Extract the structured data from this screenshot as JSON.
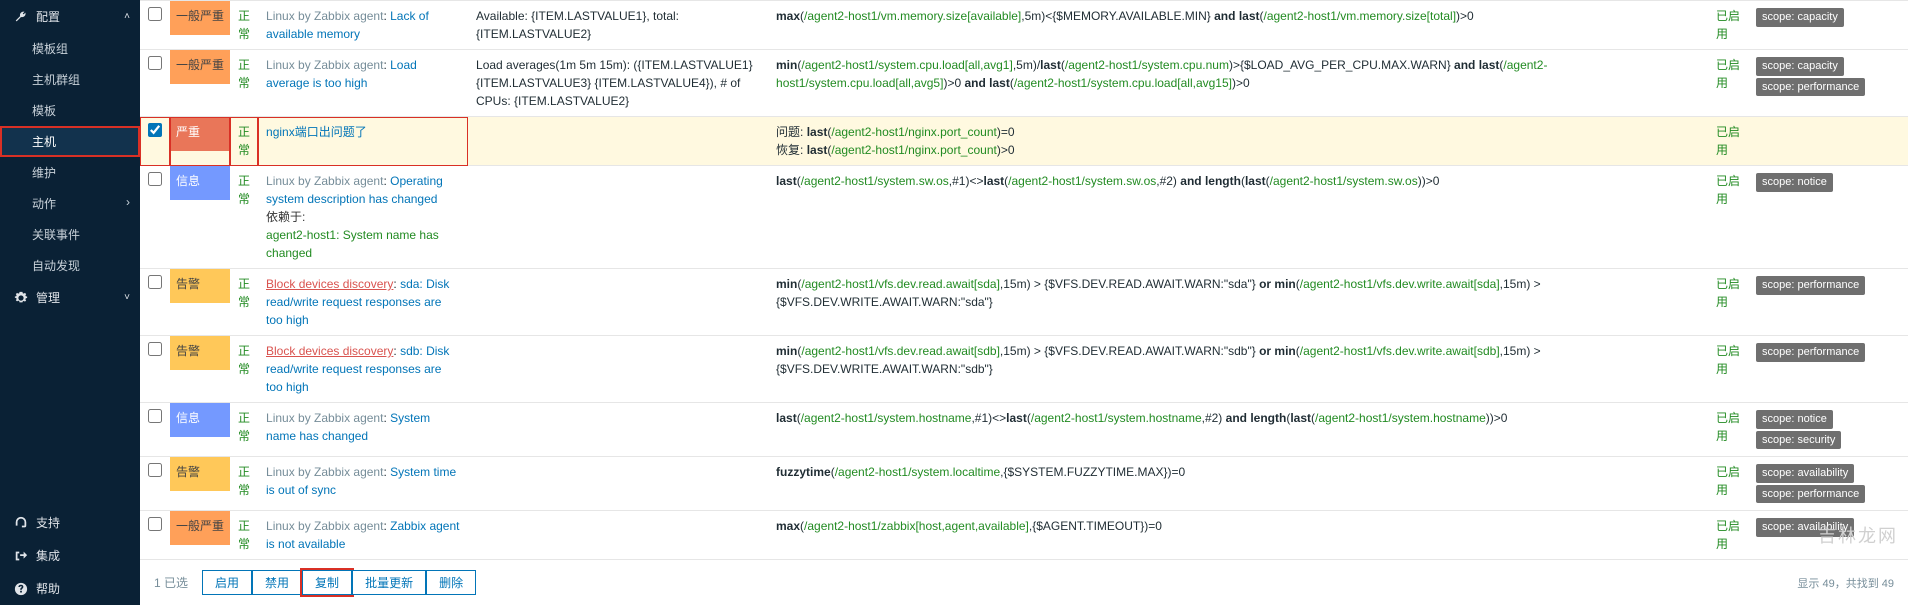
{
  "sidebar": {
    "sections": [
      {
        "label": "配置",
        "icon": "wrench",
        "expanded": true,
        "items": [
          {
            "label": "模板组"
          },
          {
            "label": "主机群组"
          },
          {
            "label": "模板"
          },
          {
            "label": "主机",
            "active": true,
            "box": true
          },
          {
            "label": "维护"
          },
          {
            "label": "动作",
            "chev": true
          },
          {
            "label": "关联事件"
          },
          {
            "label": "自动发现"
          }
        ]
      },
      {
        "label": "管理",
        "icon": "gear",
        "expanded": false,
        "items": []
      }
    ],
    "bottom": [
      {
        "label": "支持",
        "icon": "headset"
      },
      {
        "label": "集成",
        "icon": "share"
      },
      {
        "label": "帮助",
        "icon": "question"
      }
    ]
  },
  "rows": [
    {
      "checked": false,
      "sev": "一般严重",
      "status": "正常",
      "src": "Linux by Zabbix agent",
      "name": "Lack of available memory",
      "opdata": "Available: {ITEM.LASTVALUE1}, total: {ITEM.LASTVALUE2}",
      "expr": [
        {
          "t": "k",
          "v": "max"
        },
        {
          "t": "",
          "v": "("
        },
        {
          "t": "fn",
          "v": "/agent2-host1/vm.memory.size[available]"
        },
        {
          "t": "",
          "v": ",5m)<{$MEMORY.AVAILABLE.MIN} "
        },
        {
          "t": "k",
          "v": "and"
        },
        {
          "t": "",
          "v": " "
        },
        {
          "t": "k",
          "v": "last"
        },
        {
          "t": "",
          "v": "("
        },
        {
          "t": "fn",
          "v": "/agent2-host1/vm.memory.size[total]"
        },
        {
          "t": "",
          "v": ")>0"
        }
      ],
      "enable": "已启用",
      "tags": [
        "scope: capacity"
      ]
    },
    {
      "checked": false,
      "sev": "一般严重",
      "status": "正常",
      "src": "Linux by Zabbix agent",
      "name": "Load average is too high",
      "opdata": "Load averages(1m 5m 15m): ({ITEM.LASTVALUE1} {ITEM.LASTVALUE3} {ITEM.LASTVALUE4}), # of CPUs: {ITEM.LASTVALUE2}",
      "expr": [
        {
          "t": "k",
          "v": "min"
        },
        {
          "t": "",
          "v": "("
        },
        {
          "t": "fn",
          "v": "/agent2-host1/system.cpu.load[all,avg1]"
        },
        {
          "t": "",
          "v": ",5m)/"
        },
        {
          "t": "k",
          "v": "last"
        },
        {
          "t": "",
          "v": "("
        },
        {
          "t": "fn",
          "v": "/agent2-host1/system.cpu.num"
        },
        {
          "t": "",
          "v": ")>{$LOAD_AVG_PER_CPU.MAX.WARN} "
        },
        {
          "t": "k",
          "v": "and"
        },
        {
          "t": "",
          "v": " "
        },
        {
          "t": "k",
          "v": "last"
        },
        {
          "t": "",
          "v": "("
        },
        {
          "t": "fn",
          "v": "/agent2-host1/system.cpu.load[all,avg5]"
        },
        {
          "t": "",
          "v": ")>0 "
        },
        {
          "t": "k",
          "v": "and"
        },
        {
          "t": "",
          "v": " "
        },
        {
          "t": "k",
          "v": "last"
        },
        {
          "t": "",
          "v": "("
        },
        {
          "t": "fn",
          "v": "/agent2-host1/system.cpu.load[all,avg15]"
        },
        {
          "t": "",
          "v": ")>0"
        }
      ],
      "enable": "已启用",
      "tags": [
        "scope: capacity",
        "scope: performance"
      ]
    },
    {
      "checked": true,
      "highlight": true,
      "box": true,
      "sev": "严重",
      "status": "正常",
      "src": "",
      "name": "nginx端口出问题了",
      "opdata": "",
      "expr_lines": [
        {
          "pre": "问题: ",
          "parts": [
            {
              "t": "k",
              "v": "last"
            },
            {
              "t": "",
              "v": "("
            },
            {
              "t": "fn",
              "v": "/agent2-host1/nginx.port_count"
            },
            {
              "t": "",
              "v": ")=0"
            }
          ]
        },
        {
          "pre": "恢复: ",
          "parts": [
            {
              "t": "k",
              "v": "last"
            },
            {
              "t": "",
              "v": "("
            },
            {
              "t": "fn",
              "v": "/agent2-host1/nginx.port_count"
            },
            {
              "t": "",
              "v": ")>0"
            }
          ]
        }
      ],
      "enable": "已启用",
      "tags": []
    },
    {
      "checked": false,
      "sev": "信息",
      "status": "正常",
      "src": "Linux by Zabbix agent",
      "name": "Operating system description has changed",
      "dep_label": "依赖于:",
      "dep_link": "agent2-host1: System name has changed",
      "opdata": "",
      "expr": [
        {
          "t": "k",
          "v": "last"
        },
        {
          "t": "",
          "v": "("
        },
        {
          "t": "fn",
          "v": "/agent2-host1/system.sw.os"
        },
        {
          "t": "",
          "v": ",#1)<>"
        },
        {
          "t": "k",
          "v": "last"
        },
        {
          "t": "",
          "v": "("
        },
        {
          "t": "fn",
          "v": "/agent2-host1/system.sw.os"
        },
        {
          "t": "",
          "v": ",#2) "
        },
        {
          "t": "k",
          "v": "and"
        },
        {
          "t": "",
          "v": " "
        },
        {
          "t": "k",
          "v": "length"
        },
        {
          "t": "",
          "v": "("
        },
        {
          "t": "k",
          "v": "last"
        },
        {
          "t": "",
          "v": "("
        },
        {
          "t": "fn",
          "v": "/agent2-host1/system.sw.os"
        },
        {
          "t": "",
          "v": "))>0"
        }
      ],
      "enable": "已启用",
      "tags": [
        "scope: notice"
      ]
    },
    {
      "checked": false,
      "sev": "告警",
      "status": "正常",
      "src_red": "Block devices discovery",
      "name": "sda: Disk read/write request responses are too high",
      "opdata": "",
      "expr": [
        {
          "t": "k",
          "v": "min"
        },
        {
          "t": "",
          "v": "("
        },
        {
          "t": "fn",
          "v": "/agent2-host1/vfs.dev.read.await[sda]"
        },
        {
          "t": "",
          "v": ",15m) > {$VFS.DEV.READ.AWAIT.WARN:\"sda\"} "
        },
        {
          "t": "k",
          "v": "or"
        },
        {
          "t": "",
          "v": " "
        },
        {
          "t": "k",
          "v": "min"
        },
        {
          "t": "",
          "v": "("
        },
        {
          "t": "fn",
          "v": "/agent2-host1/vfs.dev.write.await[sda]"
        },
        {
          "t": "",
          "v": ",15m) > {$VFS.DEV.WRITE.AWAIT.WARN:\"sda\"}"
        }
      ],
      "enable": "已启用",
      "tags": [
        "scope: performance"
      ]
    },
    {
      "checked": false,
      "sev": "告警",
      "status": "正常",
      "src_red": "Block devices discovery",
      "name": "sdb: Disk read/write request responses are too high",
      "opdata": "",
      "expr": [
        {
          "t": "k",
          "v": "min"
        },
        {
          "t": "",
          "v": "("
        },
        {
          "t": "fn",
          "v": "/agent2-host1/vfs.dev.read.await[sdb]"
        },
        {
          "t": "",
          "v": ",15m) > {$VFS.DEV.READ.AWAIT.WARN:\"sdb\"} "
        },
        {
          "t": "k",
          "v": "or"
        },
        {
          "t": "",
          "v": " "
        },
        {
          "t": "k",
          "v": "min"
        },
        {
          "t": "",
          "v": "("
        },
        {
          "t": "fn",
          "v": "/agent2-host1/vfs.dev.write.await[sdb]"
        },
        {
          "t": "",
          "v": ",15m) > {$VFS.DEV.WRITE.AWAIT.WARN:\"sdb\"}"
        }
      ],
      "enable": "已启用",
      "tags": [
        "scope: performance"
      ]
    },
    {
      "checked": false,
      "sev": "信息",
      "status": "正常",
      "src": "Linux by Zabbix agent",
      "name": "System name has changed",
      "opdata": "",
      "expr": [
        {
          "t": "k",
          "v": "last"
        },
        {
          "t": "",
          "v": "("
        },
        {
          "t": "fn",
          "v": "/agent2-host1/system.hostname"
        },
        {
          "t": "",
          "v": ",#1)<>"
        },
        {
          "t": "k",
          "v": "last"
        },
        {
          "t": "",
          "v": "("
        },
        {
          "t": "fn",
          "v": "/agent2-host1/system.hostname"
        },
        {
          "t": "",
          "v": ",#2) "
        },
        {
          "t": "k",
          "v": "and"
        },
        {
          "t": "",
          "v": " "
        },
        {
          "t": "k",
          "v": "length"
        },
        {
          "t": "",
          "v": "("
        },
        {
          "t": "k",
          "v": "last"
        },
        {
          "t": "",
          "v": "("
        },
        {
          "t": "fn",
          "v": "/agent2-host1/system.hostname"
        },
        {
          "t": "",
          "v": "))>0"
        }
      ],
      "enable": "已启用",
      "tags": [
        "scope: notice",
        "scope: security"
      ]
    },
    {
      "checked": false,
      "sev": "告警",
      "status": "正常",
      "src": "Linux by Zabbix agent",
      "name": "System time is out of sync",
      "opdata": "",
      "expr": [
        {
          "t": "k",
          "v": "fuzzytime"
        },
        {
          "t": "",
          "v": "("
        },
        {
          "t": "fn",
          "v": "/agent2-host1/system.localtime"
        },
        {
          "t": "",
          "v": ",{$SYSTEM.FUZZYTIME.MAX})=0"
        }
      ],
      "enable": "已启用",
      "tags": [
        "scope: availability",
        "scope: performance"
      ]
    },
    {
      "checked": false,
      "sev": "一般严重",
      "status": "正常",
      "src": "Linux by Zabbix agent",
      "name": "Zabbix agent is not available",
      "opdata": "",
      "expr": [
        {
          "t": "k",
          "v": "max"
        },
        {
          "t": "",
          "v": "("
        },
        {
          "t": "fn",
          "v": "/agent2-host1/zabbix[host,agent,available]"
        },
        {
          "t": "",
          "v": ",{$AGENT.TIMEOUT})=0"
        }
      ],
      "enable": "已启用",
      "tags": [
        "scope: availability"
      ]
    }
  ],
  "footer": {
    "selected": "1 已选",
    "buttons": [
      {
        "label": "启用",
        "box": false
      },
      {
        "label": "禁用",
        "box": false
      },
      {
        "label": "复制",
        "box": true
      },
      {
        "label": "批量更新",
        "box": false
      },
      {
        "label": "删除",
        "box": false
      }
    ],
    "summary": "显示 49，共找到 49",
    "watermark": "吉林龙网"
  }
}
